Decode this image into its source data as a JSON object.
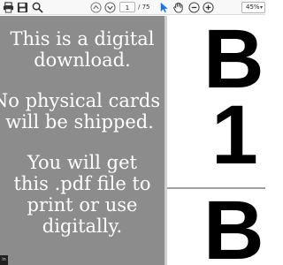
{
  "toolbar": {
    "icons": [
      "print-icon",
      "save-icon",
      "search-icon",
      "page-up-icon",
      "page-down-icon",
      "select-cursor-icon",
      "hand-icon",
      "zoom-out-icon",
      "zoom-in-icon"
    ],
    "page_current": "1",
    "page_total": "/ 75",
    "zoom": "45%"
  },
  "document": {
    "promo_lines_1": [
      "This is a digital",
      "download."
    ],
    "promo_lines_2": [
      "No physical cards",
      "will be shipped."
    ],
    "promo_lines_3": [
      "You will get",
      "this .pdf file to",
      "print or use",
      "digitally."
    ],
    "card_top_letter": "B",
    "card_number": "1",
    "card_next_letter": "B"
  },
  "corner_badge": "in",
  "colors": {
    "panel_gray": "#8c8c8c",
    "toolbar_bg": "#f8f8f8",
    "cursor_blue": "#1a73e8"
  }
}
